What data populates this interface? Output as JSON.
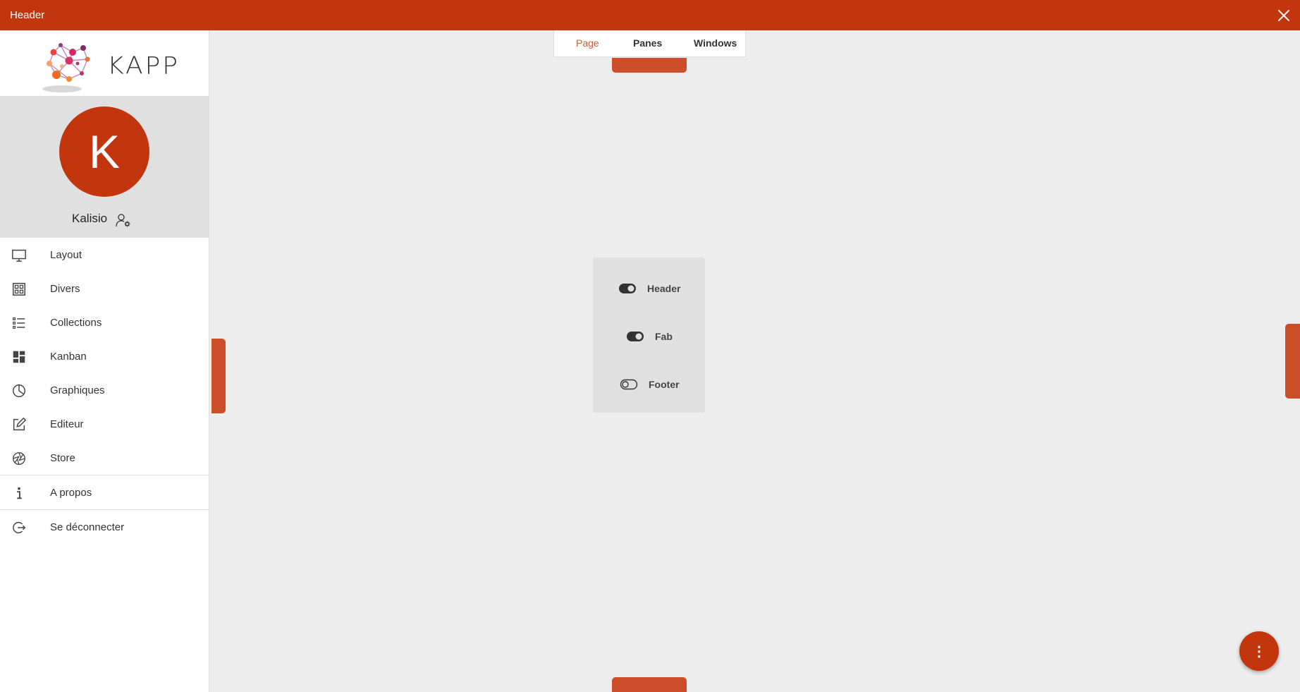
{
  "header": {
    "title": "Header",
    "close_icon": "close-icon"
  },
  "sidebar": {
    "logo_text": "KAPP",
    "profile": {
      "initial": "K",
      "name": "Kalisio",
      "settings_icon": "user-settings-icon"
    },
    "items": [
      {
        "label": "Layout",
        "icon": "monitor-icon"
      },
      {
        "label": "Divers",
        "icon": "grid-icon"
      },
      {
        "label": "Collections",
        "icon": "list-icon"
      },
      {
        "label": "Kanban",
        "icon": "dashboard-icon"
      },
      {
        "label": "Graphiques",
        "icon": "pie-chart-icon"
      },
      {
        "label": "Editeur",
        "icon": "edit-icon"
      },
      {
        "label": "Store",
        "icon": "aperture-icon"
      },
      {
        "label": "A propos",
        "icon": "info-icon"
      },
      {
        "label": "Se déconnecter",
        "icon": "logout-icon"
      }
    ]
  },
  "tabs": [
    {
      "label": "Page",
      "active": true
    },
    {
      "label": "Panes",
      "active": false
    },
    {
      "label": "Windows",
      "active": false
    }
  ],
  "panel": {
    "toggles": [
      {
        "label": "Header",
        "on": true
      },
      {
        "label": "Fab",
        "on": true
      },
      {
        "label": "Footer",
        "on": false
      }
    ]
  },
  "fab": {
    "icon": "more-vertical-icon",
    "symbol": "⋮"
  },
  "colors": {
    "accent": "#c3360d",
    "handle": "#cc4f29",
    "active_tab": "#d9582f",
    "background": "#ededed",
    "panel": "#e0e0e0"
  }
}
